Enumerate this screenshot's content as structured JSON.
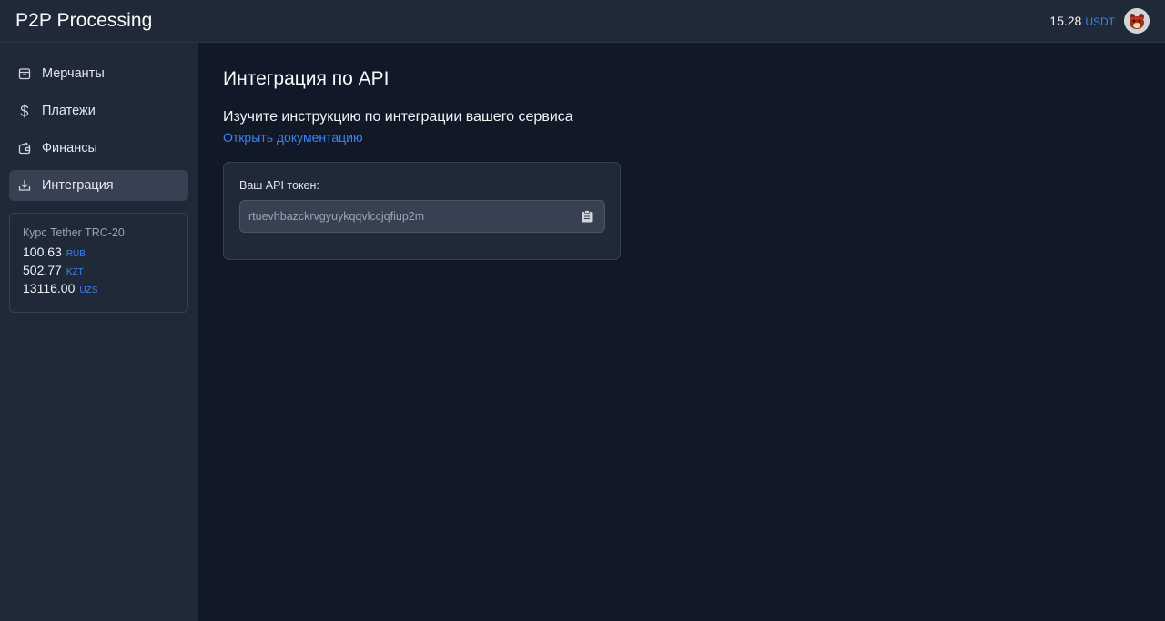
{
  "header": {
    "brand": "P2P Processing",
    "balance_value": "15.28",
    "balance_currency": "USDT"
  },
  "sidebar": {
    "items": [
      {
        "label": "Мерчанты",
        "icon": "store-icon"
      },
      {
        "label": "Платежи",
        "icon": "dollar-icon"
      },
      {
        "label": "Финансы",
        "icon": "wallet-icon"
      },
      {
        "label": "Интеграция",
        "icon": "download-icon",
        "active": true
      }
    ],
    "rates": {
      "title": "Курс Tether TRC-20",
      "rows": [
        {
          "value": "100.63",
          "currency": "RUB"
        },
        {
          "value": "502.77",
          "currency": "KZT"
        },
        {
          "value": "13116.00",
          "currency": "UZS"
        }
      ]
    }
  },
  "main": {
    "title": "Интеграция по API",
    "subtitle": "Изучите инструкцию по интеграции вашего сервиса",
    "doc_link": "Открыть документацию",
    "token_label": "Ваш API токен:",
    "token_value": "rtuevhbazckrvgyuykqqvlccjqfiup2m"
  },
  "colors": {
    "accent": "#3b82f6",
    "background": "#111827",
    "panel": "#1f2937"
  }
}
